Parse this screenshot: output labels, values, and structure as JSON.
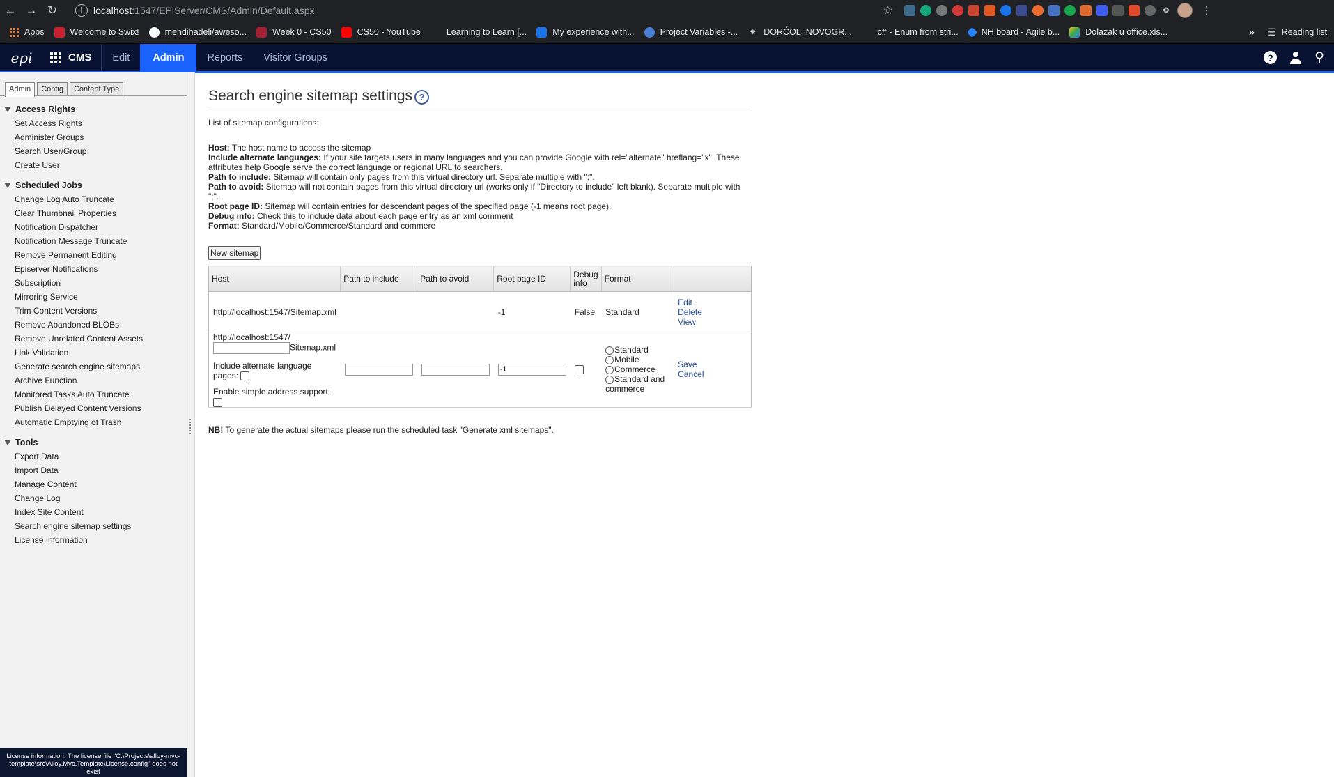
{
  "browser": {
    "url_host": "localhost",
    "url_path": ":1547/EPiServer/CMS/Admin/Default.aspx",
    "info_icon": "i",
    "bookmarks": [
      {
        "label": "Apps"
      },
      {
        "label": "Welcome to Swix!"
      },
      {
        "label": "mehdihadeli/aweso..."
      },
      {
        "label": "Week 0 - CS50"
      },
      {
        "label": "CS50 - YouTube"
      },
      {
        "label": "Learning to Learn [..."
      },
      {
        "label": "My experience with..."
      },
      {
        "label": "Project Variables -..."
      },
      {
        "label": "DORĆOL, NOVOGR..."
      },
      {
        "label": "c# - Enum from stri..."
      },
      {
        "label": "NH board - Agile b..."
      },
      {
        "label": "Dolazak u office.xls..."
      }
    ],
    "reading_list": "Reading list",
    "bookmark_overflow": "»"
  },
  "epi": {
    "cms": "CMS",
    "tabs": [
      {
        "label": "Edit"
      },
      {
        "label": "Admin"
      },
      {
        "label": "Reports"
      },
      {
        "label": "Visitor Groups"
      }
    ],
    "help_icon": "?"
  },
  "sidebar": {
    "tabs": [
      {
        "label": "Admin"
      },
      {
        "label": "Config"
      },
      {
        "label": "Content Type"
      }
    ],
    "sections": [
      {
        "title": "Access Rights",
        "items": [
          "Set Access Rights",
          "Administer Groups",
          "Search User/Group",
          "Create User"
        ]
      },
      {
        "title": "Scheduled Jobs",
        "items": [
          "Change Log Auto Truncate",
          "Clear Thumbnail Properties",
          "Notification Dispatcher",
          "Notification Message Truncate",
          "Remove Permanent Editing",
          "Episerver Notifications",
          "Subscription",
          "Mirroring Service",
          "Trim Content Versions",
          "Remove Abandoned BLOBs",
          "Remove Unrelated Content Assets",
          "Link Validation",
          "Generate search engine sitemaps",
          "Archive Function",
          "Monitored Tasks Auto Truncate",
          "Publish Delayed Content Versions",
          "Automatic Emptying of Trash"
        ]
      },
      {
        "title": "Tools",
        "items": [
          "Export Data",
          "Import Data",
          "Manage Content",
          "Change Log",
          "Index Site Content",
          "Search engine sitemap settings",
          "License Information"
        ]
      }
    ],
    "license": "License information: The license file \"C:\\Projects\\alloy-mvc-template\\src\\Alloy.Mvc.Template\\License.config\" does not exist"
  },
  "main": {
    "title": "Search engine sitemap settings",
    "help_icon": "?",
    "intro": "List of sitemap configurations:",
    "desc": [
      {
        "label": "Host:",
        "text": " The host name to access the sitemap"
      },
      {
        "label": "Include alternate languages:",
        "text": " If your site targets users in many languages and you can provide Google with rel=\"alternate\" hreflang=\"x\". These attributes help Google serve the correct language or regional URL to searchers."
      },
      {
        "label": "Path to include:",
        "text": " Sitemap will contain only pages from this virtual directory url. Separate multiple with \";\"."
      },
      {
        "label": "Path to avoid:",
        "text": " Sitemap will not contain pages from this virtual directory url (works only if \"Directory to include\" left blank). Separate multiple with \";\"."
      },
      {
        "label": "Root page ID:",
        "text": " Sitemap will contain entries for descendant pages of the specified page (-1 means root page)."
      },
      {
        "label": "Debug info:",
        "text": " Check this to include data about each page entry as an xml comment"
      },
      {
        "label": "Format:",
        "text": " Standard/Mobile/Commerce/Standard and commere"
      }
    ],
    "new_button": "New sitemap",
    "columns": [
      "Host",
      "Path to include",
      "Path to avoid",
      "Root page ID",
      "Debug info",
      "Format",
      ""
    ],
    "row": {
      "host": "http://localhost:1547/Sitemap.xml",
      "path_include": "",
      "path_avoid": "",
      "root_id": "-1",
      "debug": "False",
      "format": "Standard",
      "actions": [
        "Edit",
        "Delete",
        "View"
      ]
    },
    "edit_row": {
      "host_prefix": "http://localhost:1547/",
      "host_suffix": "Sitemap.xml",
      "host_input_value": "",
      "include_alt_label": "Include alternate language pages:",
      "simple_address_label": "Enable simple address support:",
      "path_include_value": "",
      "path_avoid_value": "",
      "root_id_value": "-1",
      "formats": [
        "Standard",
        "Mobile",
        "Commerce",
        "Standard and commerce"
      ],
      "actions": [
        "Save",
        "Cancel"
      ]
    },
    "nb_label": "NB!",
    "nb_text": " To generate the actual sitemaps please run the scheduled task \"Generate xml sitemaps\"."
  }
}
